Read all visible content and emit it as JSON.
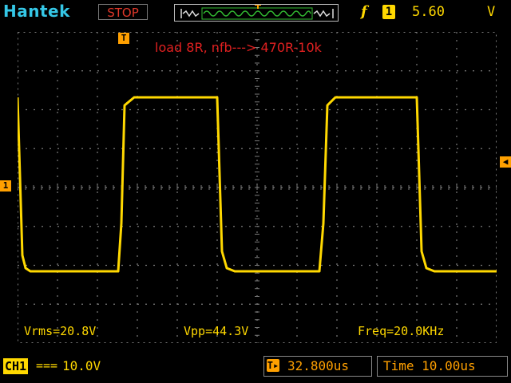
{
  "header": {
    "brand": "Hantek",
    "run_state": "STOP",
    "trigger_slope_symbol": "f",
    "trigger_channel": "1",
    "trigger_level": "5.60",
    "trigger_unit": "V"
  },
  "screen": {
    "annotation": "load 8R, nfb---> 470R-10k",
    "trigger_time_marker": "T",
    "channel_marker": "1"
  },
  "measurements": {
    "vrms": "Vrms=20.8V",
    "vpp": "Vpp=44.3V",
    "freq": "Freq=20.0KHz"
  },
  "footer": {
    "channel": "CH1",
    "coupling": "===",
    "volt_div": "10.0V",
    "horizontal_position": "32.800us",
    "timebase": "Time 10.00us"
  },
  "colors": {
    "trace": "#ffd800",
    "grid": "#7a7a7a",
    "brand": "#35c7e6",
    "stop": "#e0382a",
    "marker": "#ffa000"
  }
}
